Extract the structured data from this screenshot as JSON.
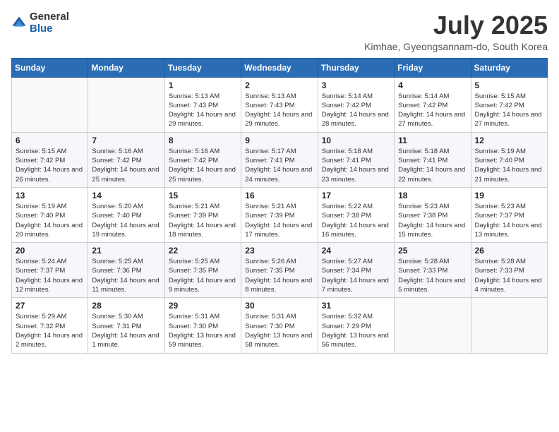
{
  "logo": {
    "general": "General",
    "blue": "Blue"
  },
  "title": "July 2025",
  "subtitle": "Kimhae, Gyeongsannam-do, South Korea",
  "weekdays": [
    "Sunday",
    "Monday",
    "Tuesday",
    "Wednesday",
    "Thursday",
    "Friday",
    "Saturday"
  ],
  "weeks": [
    [
      {
        "day": "",
        "detail": ""
      },
      {
        "day": "",
        "detail": ""
      },
      {
        "day": "1",
        "detail": "Sunrise: 5:13 AM\nSunset: 7:43 PM\nDaylight: 14 hours and 29 minutes."
      },
      {
        "day": "2",
        "detail": "Sunrise: 5:13 AM\nSunset: 7:43 PM\nDaylight: 14 hours and 29 minutes."
      },
      {
        "day": "3",
        "detail": "Sunrise: 5:14 AM\nSunset: 7:42 PM\nDaylight: 14 hours and 28 minutes."
      },
      {
        "day": "4",
        "detail": "Sunrise: 5:14 AM\nSunset: 7:42 PM\nDaylight: 14 hours and 27 minutes."
      },
      {
        "day": "5",
        "detail": "Sunrise: 5:15 AM\nSunset: 7:42 PM\nDaylight: 14 hours and 27 minutes."
      }
    ],
    [
      {
        "day": "6",
        "detail": "Sunrise: 5:15 AM\nSunset: 7:42 PM\nDaylight: 14 hours and 26 minutes."
      },
      {
        "day": "7",
        "detail": "Sunrise: 5:16 AM\nSunset: 7:42 PM\nDaylight: 14 hours and 25 minutes."
      },
      {
        "day": "8",
        "detail": "Sunrise: 5:16 AM\nSunset: 7:42 PM\nDaylight: 14 hours and 25 minutes."
      },
      {
        "day": "9",
        "detail": "Sunrise: 5:17 AM\nSunset: 7:41 PM\nDaylight: 14 hours and 24 minutes."
      },
      {
        "day": "10",
        "detail": "Sunrise: 5:18 AM\nSunset: 7:41 PM\nDaylight: 14 hours and 23 minutes."
      },
      {
        "day": "11",
        "detail": "Sunrise: 5:18 AM\nSunset: 7:41 PM\nDaylight: 14 hours and 22 minutes."
      },
      {
        "day": "12",
        "detail": "Sunrise: 5:19 AM\nSunset: 7:40 PM\nDaylight: 14 hours and 21 minutes."
      }
    ],
    [
      {
        "day": "13",
        "detail": "Sunrise: 5:19 AM\nSunset: 7:40 PM\nDaylight: 14 hours and 20 minutes."
      },
      {
        "day": "14",
        "detail": "Sunrise: 5:20 AM\nSunset: 7:40 PM\nDaylight: 14 hours and 19 minutes."
      },
      {
        "day": "15",
        "detail": "Sunrise: 5:21 AM\nSunset: 7:39 PM\nDaylight: 14 hours and 18 minutes."
      },
      {
        "day": "16",
        "detail": "Sunrise: 5:21 AM\nSunset: 7:39 PM\nDaylight: 14 hours and 17 minutes."
      },
      {
        "day": "17",
        "detail": "Sunrise: 5:22 AM\nSunset: 7:38 PM\nDaylight: 14 hours and 16 minutes."
      },
      {
        "day": "18",
        "detail": "Sunrise: 5:23 AM\nSunset: 7:38 PM\nDaylight: 14 hours and 15 minutes."
      },
      {
        "day": "19",
        "detail": "Sunrise: 5:23 AM\nSunset: 7:37 PM\nDaylight: 14 hours and 13 minutes."
      }
    ],
    [
      {
        "day": "20",
        "detail": "Sunrise: 5:24 AM\nSunset: 7:37 PM\nDaylight: 14 hours and 12 minutes."
      },
      {
        "day": "21",
        "detail": "Sunrise: 5:25 AM\nSunset: 7:36 PM\nDaylight: 14 hours and 11 minutes."
      },
      {
        "day": "22",
        "detail": "Sunrise: 5:25 AM\nSunset: 7:35 PM\nDaylight: 14 hours and 9 minutes."
      },
      {
        "day": "23",
        "detail": "Sunrise: 5:26 AM\nSunset: 7:35 PM\nDaylight: 14 hours and 8 minutes."
      },
      {
        "day": "24",
        "detail": "Sunrise: 5:27 AM\nSunset: 7:34 PM\nDaylight: 14 hours and 7 minutes."
      },
      {
        "day": "25",
        "detail": "Sunrise: 5:28 AM\nSunset: 7:33 PM\nDaylight: 14 hours and 5 minutes."
      },
      {
        "day": "26",
        "detail": "Sunrise: 5:28 AM\nSunset: 7:33 PM\nDaylight: 14 hours and 4 minutes."
      }
    ],
    [
      {
        "day": "27",
        "detail": "Sunrise: 5:29 AM\nSunset: 7:32 PM\nDaylight: 14 hours and 2 minutes."
      },
      {
        "day": "28",
        "detail": "Sunrise: 5:30 AM\nSunset: 7:31 PM\nDaylight: 14 hours and 1 minute."
      },
      {
        "day": "29",
        "detail": "Sunrise: 5:31 AM\nSunset: 7:30 PM\nDaylight: 13 hours and 59 minutes."
      },
      {
        "day": "30",
        "detail": "Sunrise: 5:31 AM\nSunset: 7:30 PM\nDaylight: 13 hours and 58 minutes."
      },
      {
        "day": "31",
        "detail": "Sunrise: 5:32 AM\nSunset: 7:29 PM\nDaylight: 13 hours and 56 minutes."
      },
      {
        "day": "",
        "detail": ""
      },
      {
        "day": "",
        "detail": ""
      }
    ]
  ]
}
